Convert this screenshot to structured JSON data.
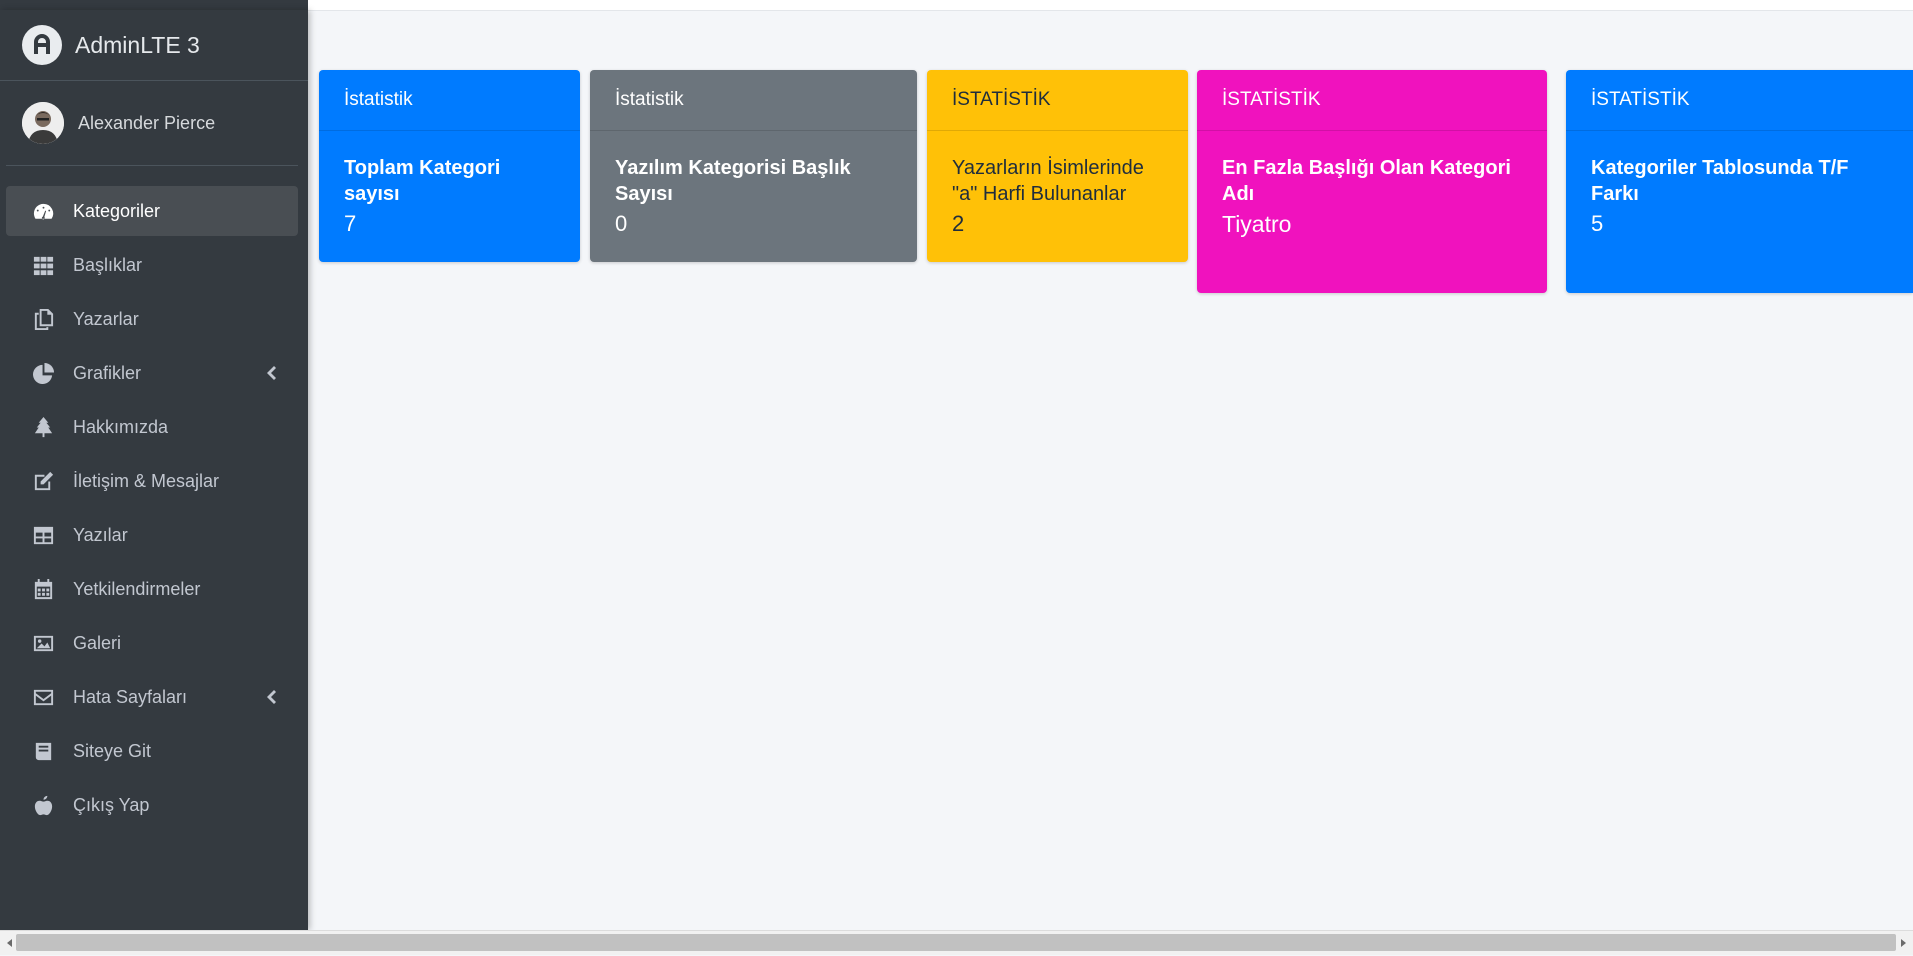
{
  "brand": {
    "name": "AdminLTE 3"
  },
  "user": {
    "name": "Alexander Pierce"
  },
  "sidebar": {
    "items": [
      {
        "label": "Kategoriler",
        "icon": "tachometer-icon",
        "active": true
      },
      {
        "label": "Başlıklar",
        "icon": "grid-icon"
      },
      {
        "label": "Yazarlar",
        "icon": "copy-icon"
      },
      {
        "label": "Grafikler",
        "icon": "pie-chart-icon",
        "has_children": true
      },
      {
        "label": "Hakkımızda",
        "icon": "tree-icon"
      },
      {
        "label": "İletişim & Mesajlar",
        "icon": "edit-icon"
      },
      {
        "label": "Yazılar",
        "icon": "table-icon"
      },
      {
        "label": "Yetkilendirmeler",
        "icon": "calendar-icon"
      },
      {
        "label": "Galeri",
        "icon": "image-icon"
      },
      {
        "label": "Hata Sayfaları",
        "icon": "envelope-icon",
        "has_children": true
      },
      {
        "label": "Siteye Git",
        "icon": "book-icon"
      },
      {
        "label": "Çıkış Yap",
        "icon": "apple-icon"
      }
    ]
  },
  "cards": [
    {
      "header": "İstatistik",
      "title": "Toplam Kategori sayısı",
      "value": "7",
      "color": "#007bff"
    },
    {
      "header": "İstatistik",
      "title": "Yazılım Kategorisi Başlık Sayısı",
      "value": "0",
      "color": "#6c757d"
    },
    {
      "header": "İSTATİSTİK",
      "title": "Yazarların İsimlerinde \"a\" Harfi Bulunanlar",
      "value": "2",
      "color": "#ffc107"
    },
    {
      "header": "İSTATİSTİK",
      "title": "En Fazla Başlığı Olan Kategori Adı",
      "value": "Tiyatro",
      "color": "#f012be"
    },
    {
      "header": "İSTATİSTİK",
      "title": "Kategoriler Tablosunda T/F Farkı",
      "value": "5",
      "color": "#007bff"
    }
  ]
}
